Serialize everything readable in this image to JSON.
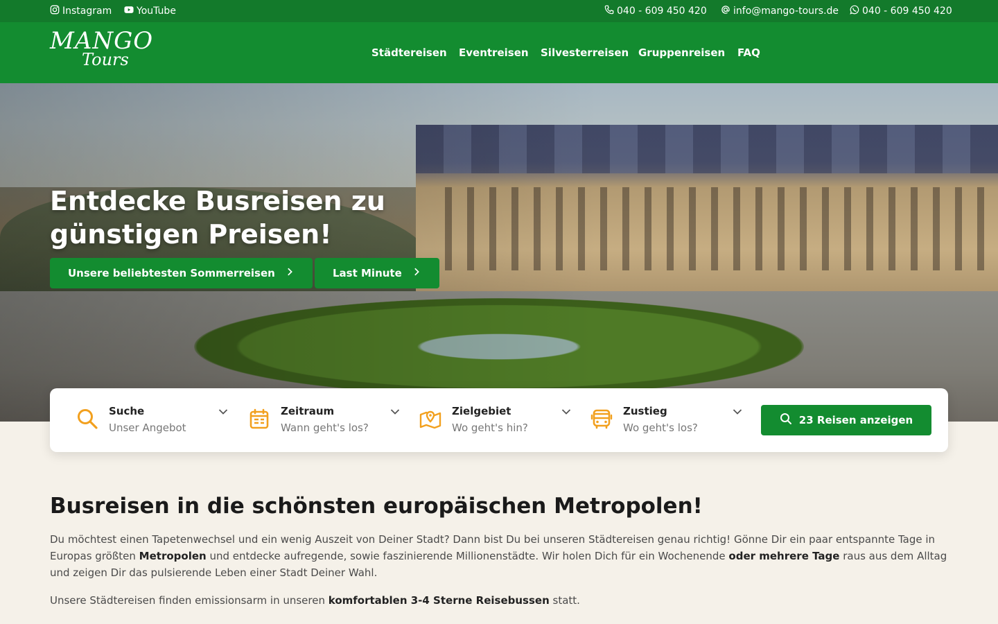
{
  "topbar": {
    "instagram": "Instagram",
    "youtube": "YouTube",
    "phone": "040 - 609 450 420",
    "email": "info@mango-tours.de",
    "whatsapp": "040 - 609 450 420"
  },
  "brand": {
    "line1": "MANGO",
    "line2": "Tours"
  },
  "nav": [
    "Städtereisen",
    "Eventreisen",
    "Silvesterreisen",
    "Gruppenreisen",
    "FAQ"
  ],
  "hero": {
    "headline": "Entdecke Busreisen zu günstigen Preisen!",
    "cta_primary": "Unsere beliebtesten Sommerreisen",
    "cta_secondary": "Last Minute"
  },
  "search": {
    "fields": [
      {
        "title": "Suche",
        "placeholder": "Unser Angebot",
        "icon": "search-icon"
      },
      {
        "title": "Zeitraum",
        "placeholder": "Wann geht's los?",
        "icon": "calendar-icon"
      },
      {
        "title": "Zielgebiet",
        "placeholder": "Wo geht's hin?",
        "icon": "map-icon"
      },
      {
        "title": "Zustieg",
        "placeholder": "Wo geht's los?",
        "icon": "bus-icon"
      }
    ],
    "button": "23 Reisen anzeigen"
  },
  "content": {
    "heading": "Busreisen in die schönsten europäischen Metropolen!",
    "p1_a": "Du möchtest einen Tapetenwechsel und ein wenig Auszeit von Deiner Stadt? Dann bist Du bei unseren Städtereisen genau richtig! Gönne Dir ein paar entspannte Tage in Europas größten ",
    "p1_b": "Metropolen",
    "p1_c": " und entdecke aufregende, sowie faszinierende Millionenstädte. Wir holen Dich für ein Wochenende ",
    "p1_d": "oder mehrere Tage",
    "p1_e": " raus aus dem Alltag und zeigen Dir das pulsierende Leben einer Stadt Deiner Wahl.",
    "p2_a": "Unsere Städtereisen finden emissionsarm in unseren ",
    "p2_b": "komfortablen 3-4 Sterne Reisebussen",
    "p2_c": " statt."
  },
  "colors": {
    "brand_green": "#138c30",
    "topbar_green": "#137a2b",
    "accent_orange": "#f2a01e",
    "background": "#f5f1e9"
  }
}
